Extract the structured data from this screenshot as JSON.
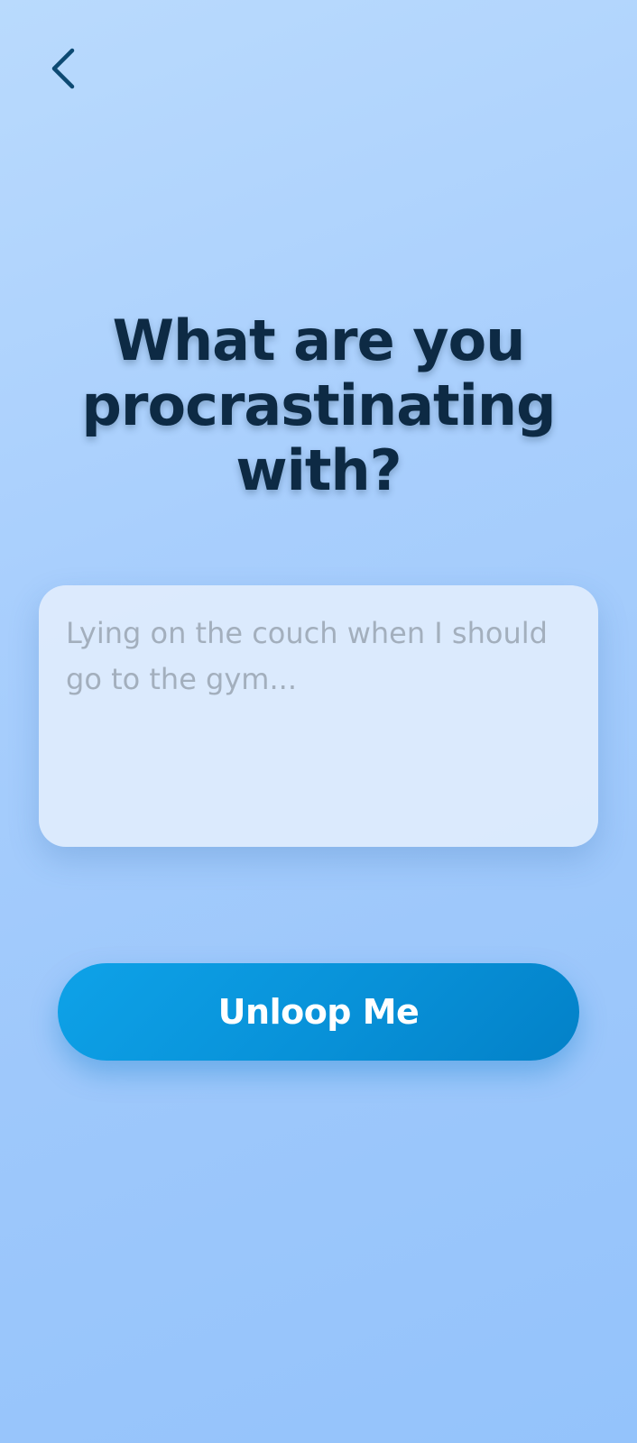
{
  "header": {
    "back_icon": "chevron-left-icon"
  },
  "main": {
    "title_lines": [
      "What are you",
      "procrastinating",
      "with?"
    ],
    "input": {
      "value": "",
      "placeholder": "Lying on the couch when I should go to the gym..."
    },
    "submit_label": "Unloop Me"
  },
  "colors": {
    "background_top": "#b9dafd",
    "background_bottom": "#94c3fb",
    "title": "#0d2a44",
    "back_icon": "#0d4a73",
    "button_start": "#0ea2e8",
    "button_end": "#0381c8",
    "button_text": "#ffffff",
    "placeholder": "#a3afbd"
  }
}
